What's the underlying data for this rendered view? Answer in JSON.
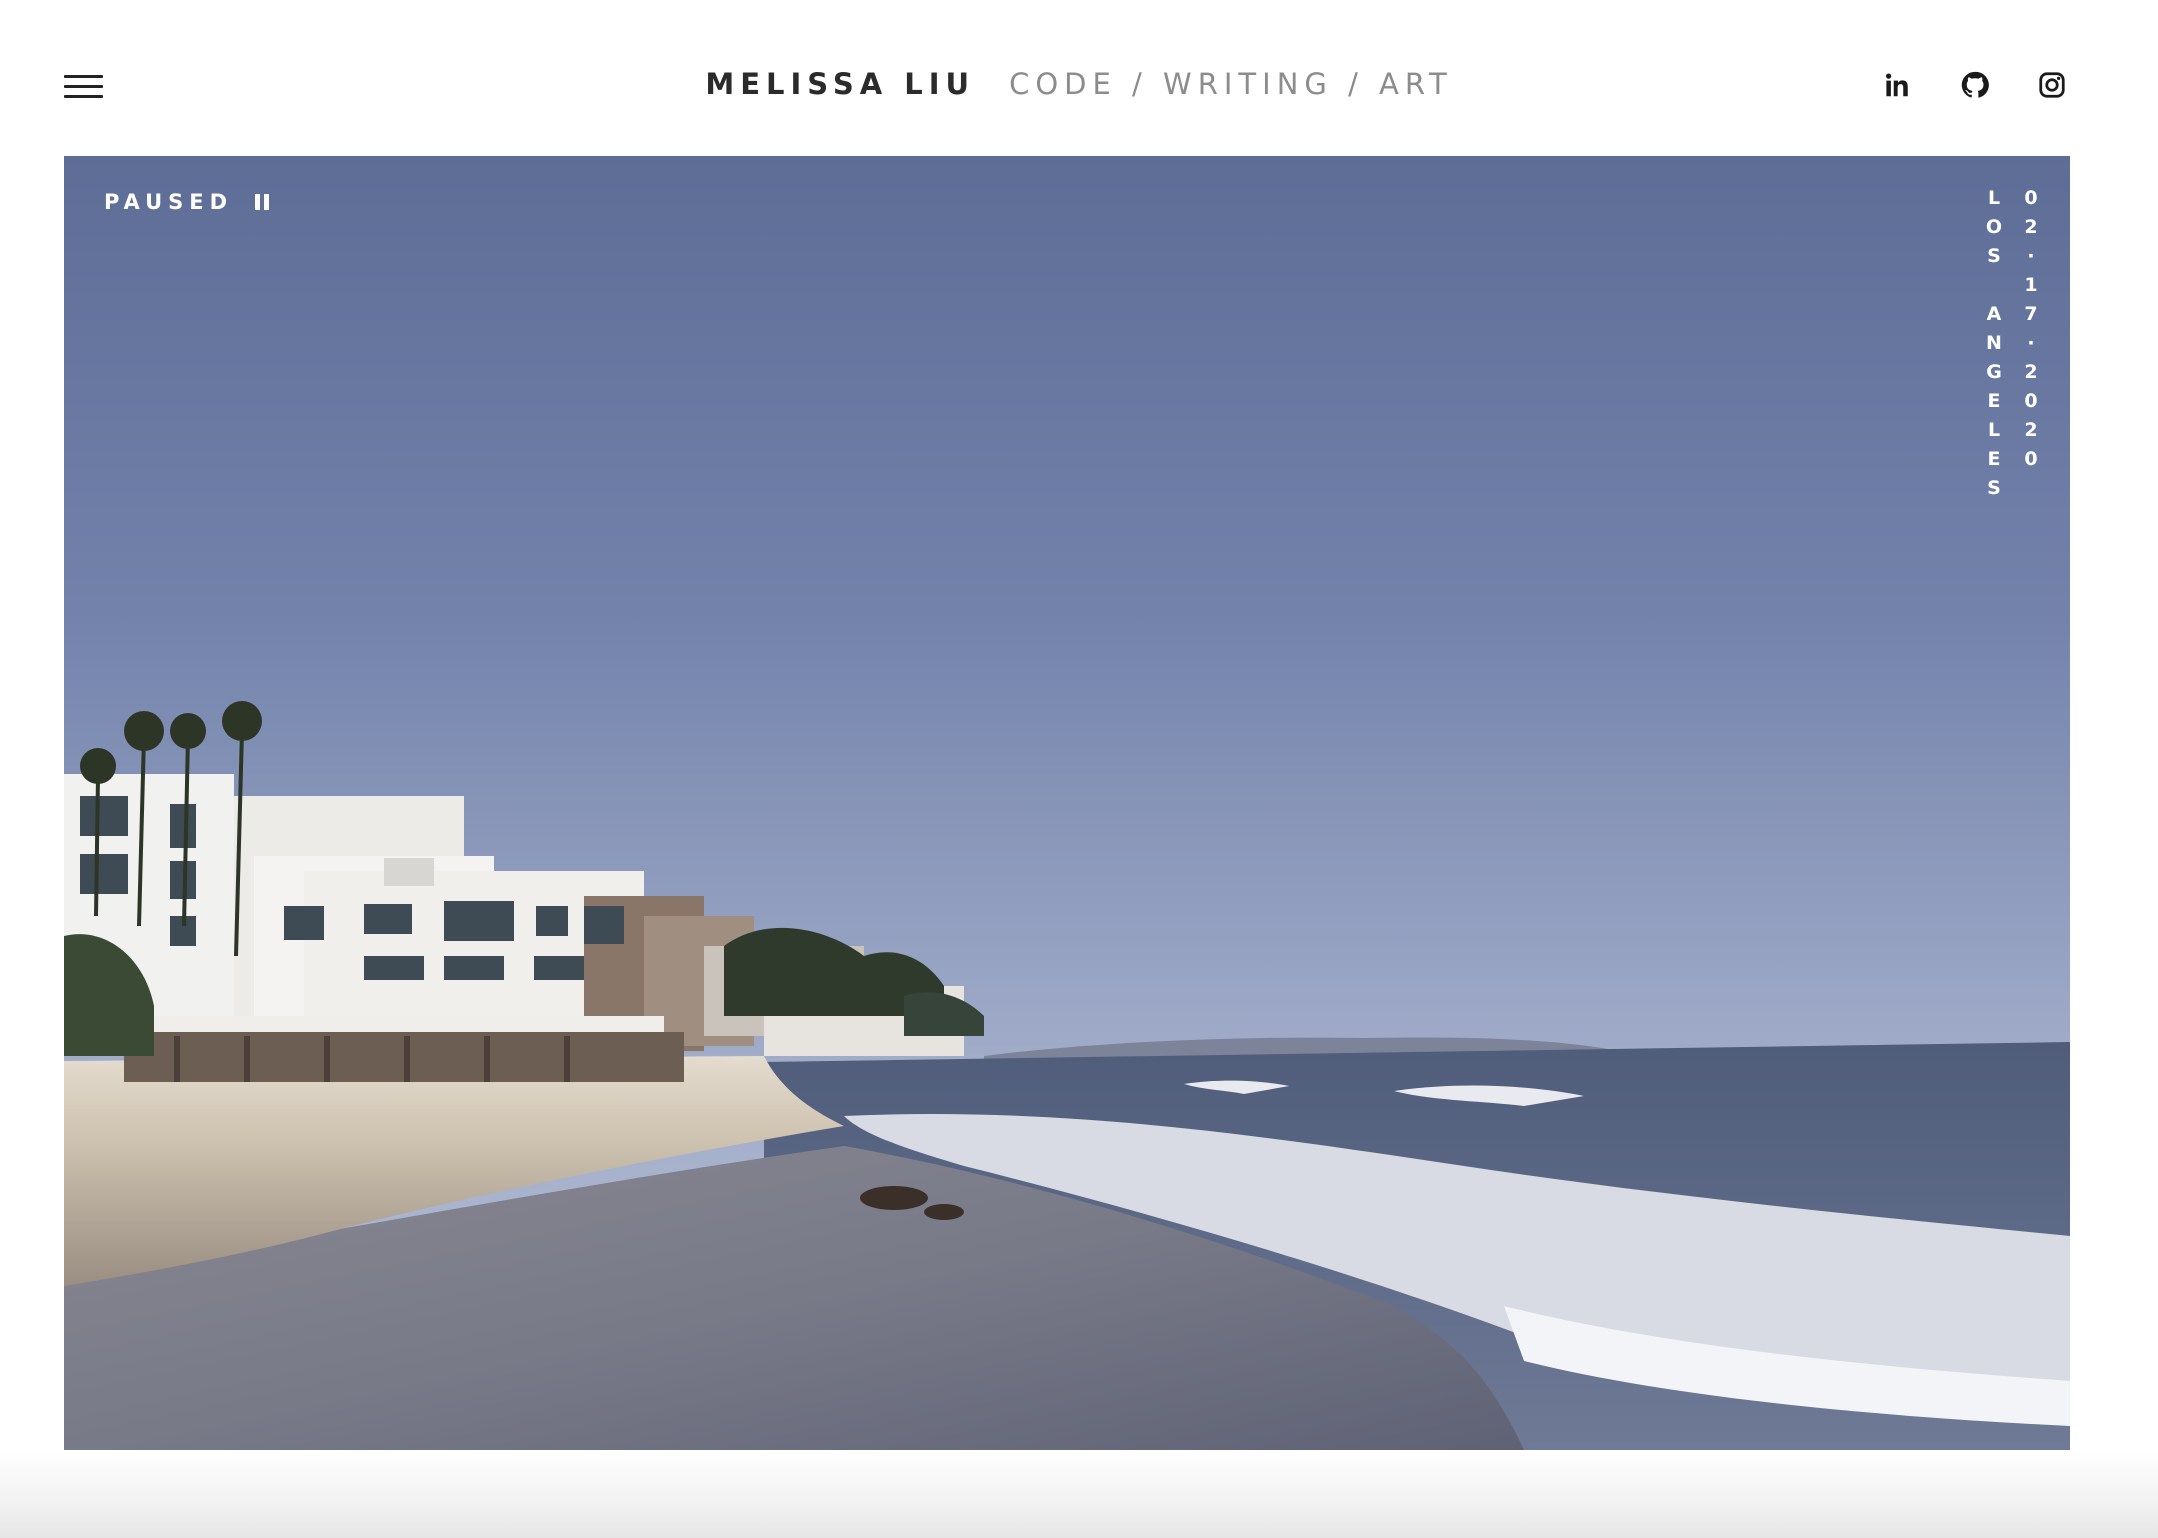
{
  "header": {
    "name": "MELISSA LIU",
    "tagline": "CODE / WRITING / ART"
  },
  "social": [
    {
      "id": "linkedin",
      "icon": "linkedin-icon"
    },
    {
      "id": "github",
      "icon": "github-icon"
    },
    {
      "id": "instagram",
      "icon": "instagram-icon"
    }
  ],
  "hero": {
    "status": "PAUSED",
    "status_icon": "pause-icon",
    "location": "LOS ANGELES",
    "date": "02·17·2020"
  },
  "colors": {
    "brand_text": "#2b2b2b",
    "tagline_text": "#8c8c8c",
    "overlay_text": "#ffffff"
  }
}
